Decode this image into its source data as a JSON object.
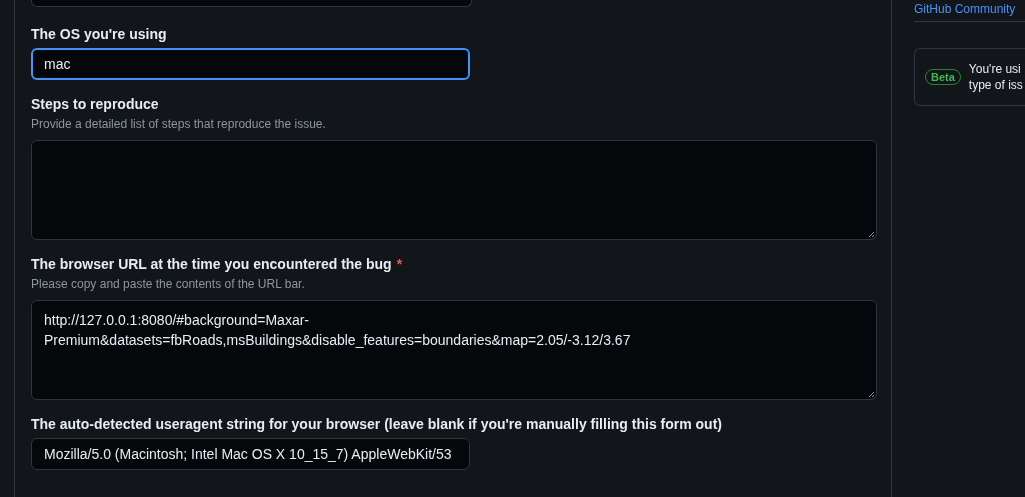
{
  "form": {
    "fields": [
      {
        "kind": "input",
        "label": "The OS you're using",
        "value": "mac",
        "focused": true
      },
      {
        "kind": "textarea",
        "label": "Steps to reproduce",
        "help": "Provide a detailed list of steps that reproduce the issue.",
        "focused": false
      },
      {
        "kind": "textarea",
        "label": "The browser URL at the time you encountered the bug",
        "required_mark": "*",
        "help": "Please copy and paste the contents of the URL bar.",
        "value": "http://127.0.0.1:8080/#background=Maxar-Premium&datasets=fbRoads,msBuildings&disable_features=boundaries&map=2.05/-3.12/3.67",
        "focused": false
      },
      {
        "kind": "input",
        "label": "The auto-detected useragent string for your browser (leave blank if you're manually filling this form out)",
        "value": "Mozilla/5.0 (Macintosh; Intel Mac OS X 10_15_7) AppleWebKit/53",
        "focused": false
      }
    ]
  },
  "sidebar": {
    "link": "GitHub Community",
    "callout": {
      "badge": "Beta",
      "lines": [
        "You're usi",
        "type of iss"
      ]
    }
  }
}
